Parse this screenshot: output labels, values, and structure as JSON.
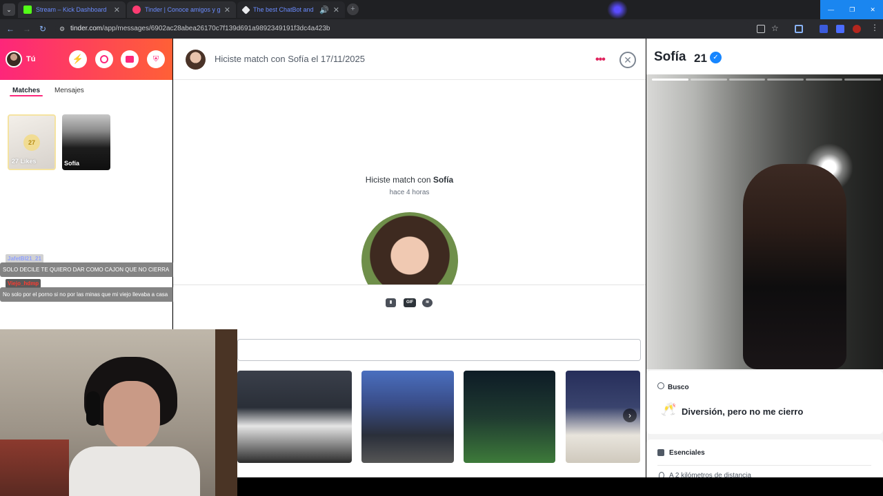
{
  "browser": {
    "tabs": [
      {
        "title": "Stream – Kick Dashboard",
        "favicon_color": "#53fc18"
      },
      {
        "title": "Tinder | Conoce amigos y gente",
        "favicon_color": "#fe3c72"
      },
      {
        "title": "The best ChatBot and Widg",
        "favicon_color": "#e8eaed"
      }
    ],
    "url_host": "tinder.com",
    "url_path": "/app/messages/6902ac28abea26170c7f139d691a9892349191f3dc4a423b"
  },
  "sidebar": {
    "user_label": "Tú",
    "tabs": [
      "Matches",
      "Mensajes"
    ],
    "likes_count": "27",
    "likes_label": "27 Likes",
    "match_name": "Sofía"
  },
  "chat_overlay": [
    {
      "user": "JafetBI21_21",
      "user_color": "#8fa0ff",
      "message": "SOLO DECILE TE QUIERO DAR COMO CAJON QUE NO CIERRA"
    },
    {
      "user": "Viejo_hdmp",
      "user_color": "#ff3b30",
      "message": "No solo por el porno si no por las minas que mi viejo llevaba a casa"
    }
  ],
  "conversation": {
    "header_title": "Hiciste match con Sofía el 17/11/2025",
    "match_prefix": "Hiciste match con ",
    "match_name": "Sofía",
    "match_time": "hace 4 horas",
    "composer_icons": [
      "sticker-icon",
      "gif-icon",
      "spotify-icon"
    ],
    "gif_button_label": "GIF"
  },
  "profile": {
    "name": "Sofía",
    "age": "21",
    "busco_label": "Busco",
    "busco_value": "Diversión, pero no me cierro",
    "esenciales_label": "Esenciales",
    "distance": "A 2 kilómetros de distancia"
  },
  "colors": {
    "brand_gradient_start": "#fd267a",
    "brand_gradient_end": "#ff6036",
    "accent": "#fd267a",
    "verified": "#1786ff"
  }
}
